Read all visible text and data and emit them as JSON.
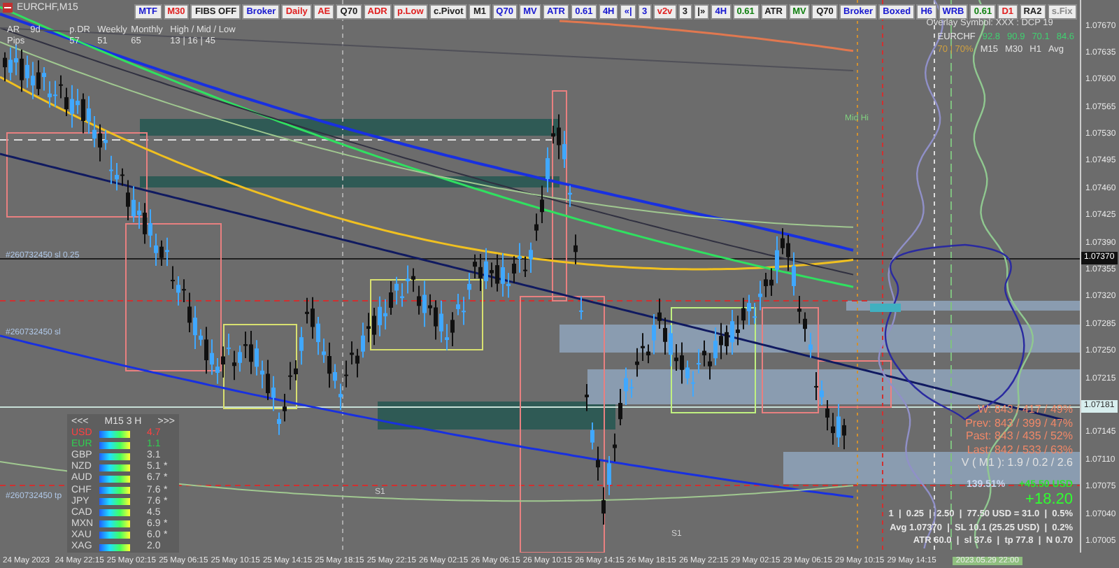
{
  "chart": {
    "title": "EURCHF,M15"
  },
  "toolbar": [
    {
      "label": "MTF",
      "color": "#1818d0"
    },
    {
      "label": "M30",
      "color": "#e02020"
    },
    {
      "label": "FIBS OFF",
      "color": "#202020"
    },
    {
      "label": "Broker",
      "color": "#1818d0"
    },
    {
      "label": "Daily",
      "color": "#e02020"
    },
    {
      "label": "AE",
      "color": "#e02020"
    },
    {
      "label": "Q70",
      "color": "#202020"
    },
    {
      "label": "ADR",
      "color": "#e02020"
    },
    {
      "label": "p.Low",
      "color": "#e02020"
    },
    {
      "label": "c.Pivot",
      "color": "#202020"
    },
    {
      "label": "M1",
      "color": "#202020"
    },
    {
      "label": "Q70",
      "color": "#1818d0"
    },
    {
      "label": "MV",
      "color": "#1818d0"
    },
    {
      "label": "ATR",
      "color": "#1818d0"
    },
    {
      "label": "0.61",
      "color": "#1818d0"
    },
    {
      "label": "4H",
      "color": "#1818d0"
    },
    {
      "label": "«|",
      "color": "#1818d0"
    },
    {
      "label": "3",
      "color": "#1818d0"
    },
    {
      "label": "v2v",
      "color": "#e02020"
    },
    {
      "label": "3",
      "color": "#202020"
    },
    {
      "label": "|»",
      "color": "#202020"
    },
    {
      "label": "4H",
      "color": "#1818d0"
    },
    {
      "label": "0.61",
      "color": "#108010"
    },
    {
      "label": "ATR",
      "color": "#202020"
    },
    {
      "label": "MV",
      "color": "#108010"
    },
    {
      "label": "Q70",
      "color": "#202020"
    },
    {
      "label": "Broker",
      "color": "#1818d0"
    },
    {
      "label": "Boxed",
      "color": "#1818d0"
    },
    {
      "label": "H6",
      "color": "#1818d0"
    },
    {
      "label": "WRB",
      "color": "#1818d0"
    },
    {
      "label": "0.61",
      "color": "#108010"
    },
    {
      "label": "D1",
      "color": "#e02020"
    },
    {
      "label": "RA2",
      "color": "#202020"
    },
    {
      "label": "s.Fix",
      "color": "#888888"
    }
  ],
  "range_panel": {
    "ar_label": "AR",
    "pips_label": "Pips",
    "columns": [
      {
        "label": "9d"
      },
      {
        "label": "p.DR",
        "value": "57"
      },
      {
        "label": "Weekly",
        "value": "51"
      },
      {
        "label": "Monthly",
        "value": "65"
      },
      {
        "label": "High / Mid / Low",
        "value": "13 | 16 | 45"
      }
    ]
  },
  "overlay": {
    "title": "Overlay Symbol: XXX : DCP 19",
    "symbol": "EURCHF",
    "values": [
      "92.8",
      "90.9",
      "70.1",
      "84.6"
    ],
    "threshold": "70 | 70%",
    "timeframes": [
      "M15",
      "M30",
      "H1",
      "Avg"
    ]
  },
  "line_labels": [
    "#260732450 sl 0.25",
    "#260732450 sl",
    "#260732450 tp",
    "Mid Hi",
    "S1",
    "S1"
  ],
  "strength": {
    "prev": "<<<",
    "timeframe": "M15 3 H",
    "next": ">>>",
    "rows": [
      {
        "name": "USD",
        "color": "#ff4040",
        "value": "4.7"
      },
      {
        "name": "EUR",
        "color": "#30d050",
        "value": "1.1"
      },
      {
        "name": "GBP",
        "color": "#d8d8d8",
        "value": "3.1"
      },
      {
        "name": "NZD",
        "color": "#d8d8d8",
        "value": "5.1",
        "flag": "*"
      },
      {
        "name": "AUD",
        "color": "#d8d8d8",
        "value": "6.7",
        "flag": "*"
      },
      {
        "name": "CHF",
        "color": "#d8d8d8",
        "value": "7.6",
        "flag": "*"
      },
      {
        "name": "JPY",
        "color": "#d8d8d8",
        "value": "7.6",
        "flag": "*"
      },
      {
        "name": "CAD",
        "color": "#d8d8d8",
        "value": "4.5"
      },
      {
        "name": "MXN",
        "color": "#d8d8d8",
        "value": "6.9",
        "flag": "*"
      },
      {
        "name": "XAU",
        "color": "#d8d8d8",
        "value": "6.0",
        "flag": "*"
      },
      {
        "name": "XAG",
        "color": "#d8d8d8",
        "value": "2.0"
      }
    ]
  },
  "stats": {
    "ranges": [
      "W: 843 / 417 / 49%",
      "Prev: 843 / 399 / 47%",
      "Past: 843 / 435 / 52%",
      "Last: 842 / 533 / 63%"
    ],
    "volume": "V ( M1 ): 1.9 / 0.2 / 2.6",
    "percent": "139.51%",
    "profit": "+45.50 USD",
    "total": "+18.20",
    "trade_lines": [
      "1  |  0.25  |  2.50  |  77.50 USD = 31.0  |  0.5%",
      "Avg 1.07370  |  SL 10.1 (25.25 USD)  |  0.2%",
      "ATR 60.0  |  sl 37.6  |  tp 77.8  |  N 0.70"
    ]
  },
  "price_axis": {
    "labels": [
      "1.07670",
      "1.07635",
      "1.07600",
      "1.07565",
      "1.07530",
      "1.07495",
      "1.07460",
      "1.07425",
      "1.07390",
      "1.07355",
      "1.07320",
      "1.07285",
      "1.07250",
      "1.07215",
      "1.07145",
      "1.07110",
      "1.07075",
      "1.07040",
      "1.07005"
    ],
    "markers": [
      "1.07370",
      "1.07181"
    ]
  },
  "time_axis": {
    "labels": [
      "24 May 2023",
      "24 May 22:15",
      "25 May 02:15",
      "25 May 06:15",
      "25 May 10:15",
      "25 May 14:15",
      "25 May 18:15",
      "25 May 22:15",
      "26 May 02:15",
      "26 May 06:15",
      "26 May 10:15",
      "26 May 14:15",
      "26 May 18:15",
      "26 May 22:15",
      "29 May 02:15",
      "29 May 06:15",
      "29 May 10:15",
      "29 May 14:15"
    ],
    "cursor": "2023.05.29 22:00"
  }
}
